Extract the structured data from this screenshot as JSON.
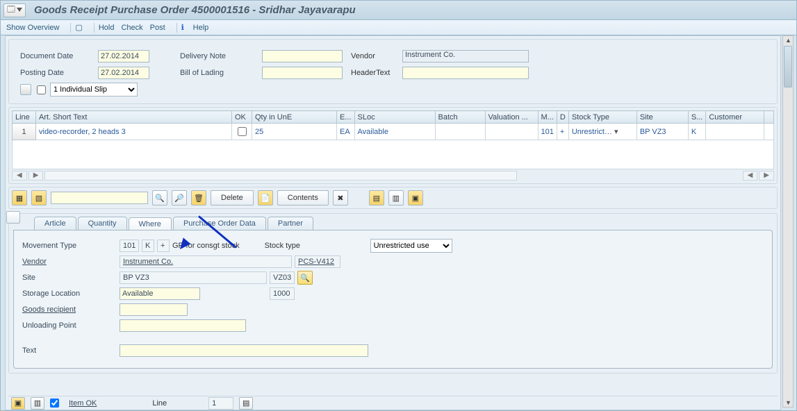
{
  "title": "Goods Receipt Purchase Order 4500001516 - Sridhar Jayavarapu",
  "toolbar": {
    "show": "Show Overview",
    "hold": "Hold",
    "check": "Check",
    "post": "Post",
    "help": "Help"
  },
  "header": {
    "docdate_lbl": "Document Date",
    "docdate": "27.02.2014",
    "postdate_lbl": "Posting Date",
    "postdate": "27.02.2014",
    "delnote_lbl": "Delivery Note",
    "bol_lbl": "Bill of Lading",
    "vendor_lbl": "Vendor",
    "vendor": "Instrument Co.",
    "htext_lbl": "HeaderText",
    "slip_opt": "1 Individual Slip"
  },
  "grid": {
    "cols": {
      "line": "Line",
      "ast": "Art. Short Text",
      "ok": "OK",
      "qty": "Qty in UnE",
      "eun": "E...",
      "sloc": "SLoc",
      "batch": "Batch",
      "val": "Valuation ...",
      "m": "M...",
      "d": "D",
      "stk": "Stock Type",
      "site": "Site",
      "s": "S...",
      "cust": "Customer"
    },
    "rows": [
      {
        "line": "1",
        "ast": "video-recorder, 2 heads 3",
        "qty": "25",
        "eun": "EA",
        "sloc": "Available",
        "m": "101",
        "d": "+",
        "stk": "Unrestrict…",
        "site": "BP VZ3",
        "s": "K"
      }
    ]
  },
  "gridtb": {
    "delete": "Delete",
    "contents": "Contents"
  },
  "tabs": {
    "article": "Article",
    "quantity": "Quantity",
    "where": "Where",
    "pod": "Purchase Order Data",
    "partner": "Partner"
  },
  "where": {
    "mvt_lbl": "Movement Type",
    "mvt": "101",
    "mvt2": "K",
    "mvt3": "+",
    "mvt_desc": "GR for consgt stock",
    "stock_lbl": "Stock type",
    "stock": "Unrestricted use",
    "vendor_lbl": "Vendor",
    "vendor": "Instrument Co.",
    "vendor_code": "PCS-V412",
    "site_lbl": "Site",
    "site": "BP VZ3",
    "site_code": "VZ03",
    "sloc_lbl": "Storage Location",
    "sloc": "Available",
    "sloc_code": "1000",
    "gr_lbl": "Goods recipient",
    "up_lbl": "Unloading Point",
    "text_lbl": "Text"
  },
  "footer": {
    "itemok": "Item OK",
    "line_lbl": "Line",
    "line": "1"
  }
}
